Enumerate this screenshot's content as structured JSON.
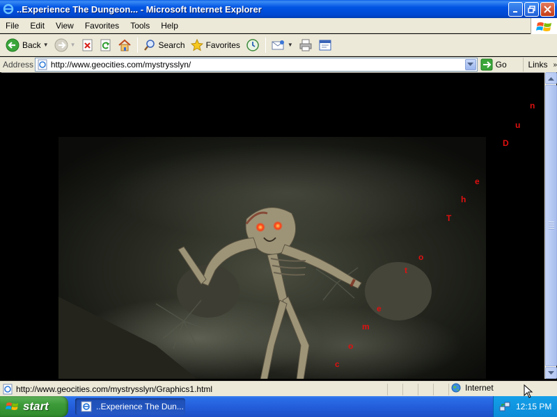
{
  "window": {
    "title": "..Experience The Dungeon... - Microsoft Internet Explorer"
  },
  "menu": [
    "File",
    "Edit",
    "View",
    "Favorites",
    "Tools",
    "Help"
  ],
  "toolbar": {
    "back_label": "Back",
    "search_label": "Search",
    "favorites_label": "Favorites"
  },
  "address": {
    "label": "Address",
    "url": "http://www.geocities.com/mystrysslyn/",
    "go_label": "Go",
    "links_label": "Links"
  },
  "page": {
    "letters": [
      "n",
      "u",
      "D",
      "e",
      "h",
      "T",
      "o",
      "t",
      "e",
      "m",
      "o",
      "c"
    ],
    "letter_color": "#e01010"
  },
  "status": {
    "text": "http://www.geocities.com/mystrysslyn/Graphics1.html",
    "zone_label": "Internet"
  },
  "taskbar": {
    "start_label": "start",
    "task_label": "..Experience The Dun...",
    "clock": "12:15 PM"
  }
}
